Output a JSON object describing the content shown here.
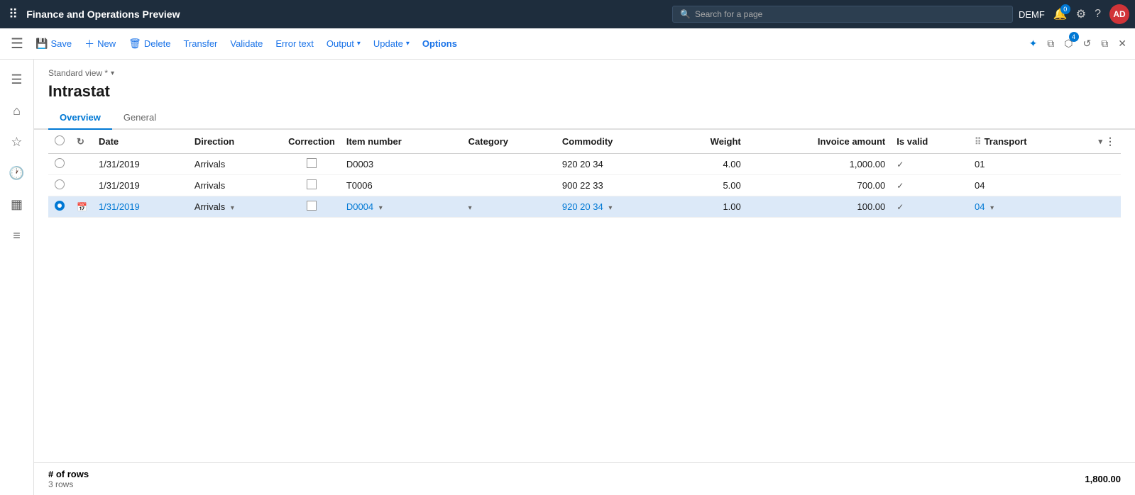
{
  "app": {
    "title": "Finance and Operations Preview",
    "env": "DEMF"
  },
  "topbar": {
    "search_placeholder": "Search for a page",
    "notification_count": "0",
    "avatar_initials": "AD"
  },
  "toolbar": {
    "save_label": "Save",
    "new_label": "New",
    "delete_label": "Delete",
    "transfer_label": "Transfer",
    "validate_label": "Validate",
    "error_text_label": "Error text",
    "output_label": "Output",
    "update_label": "Update",
    "options_label": "Options"
  },
  "page": {
    "view_label": "Standard view *",
    "title": "Intrastat"
  },
  "tabs": [
    {
      "id": "overview",
      "label": "Overview",
      "active": true
    },
    {
      "id": "general",
      "label": "General",
      "active": false
    }
  ],
  "table": {
    "columns": [
      {
        "id": "date",
        "label": "Date"
      },
      {
        "id": "direction",
        "label": "Direction"
      },
      {
        "id": "correction",
        "label": "Correction"
      },
      {
        "id": "item_number",
        "label": "Item number"
      },
      {
        "id": "category",
        "label": "Category"
      },
      {
        "id": "commodity",
        "label": "Commodity"
      },
      {
        "id": "weight",
        "label": "Weight"
      },
      {
        "id": "invoice_amount",
        "label": "Invoice amount"
      },
      {
        "id": "is_valid",
        "label": "Is valid"
      },
      {
        "id": "transport",
        "label": "Transport"
      }
    ],
    "rows": [
      {
        "selected": false,
        "date": "1/31/2019",
        "direction": "Arrivals",
        "correction": false,
        "item_number": "D0003",
        "category": "",
        "commodity": "920 20 34",
        "weight": "4.00",
        "invoice_amount": "1,000.00",
        "is_valid": true,
        "transport": "01",
        "editing": false
      },
      {
        "selected": false,
        "date": "1/31/2019",
        "direction": "Arrivals",
        "correction": false,
        "item_number": "T0006",
        "category": "",
        "commodity": "900 22 33",
        "weight": "5.00",
        "invoice_amount": "700.00",
        "is_valid": true,
        "transport": "04",
        "editing": false
      },
      {
        "selected": true,
        "date": "1/31/2019",
        "direction": "Arrivals",
        "correction": false,
        "item_number": "D0004",
        "category": "",
        "commodity": "920 20 34",
        "weight": "1.00",
        "invoice_amount": "100.00",
        "is_valid": true,
        "transport": "04",
        "editing": true
      }
    ]
  },
  "footer": {
    "rows_label": "# of rows",
    "rows_count_label": "3 rows",
    "total_value": "1,800.00"
  },
  "left_nav": {
    "items": [
      {
        "id": "menu",
        "icon": "☰",
        "label": "Menu"
      },
      {
        "id": "home",
        "icon": "⌂",
        "label": "Home"
      },
      {
        "id": "favorites",
        "icon": "★",
        "label": "Favorites"
      },
      {
        "id": "recent",
        "icon": "🕐",
        "label": "Recent"
      },
      {
        "id": "workspaces",
        "icon": "▦",
        "label": "Workspaces"
      },
      {
        "id": "list",
        "icon": "≡",
        "label": "List"
      }
    ]
  }
}
